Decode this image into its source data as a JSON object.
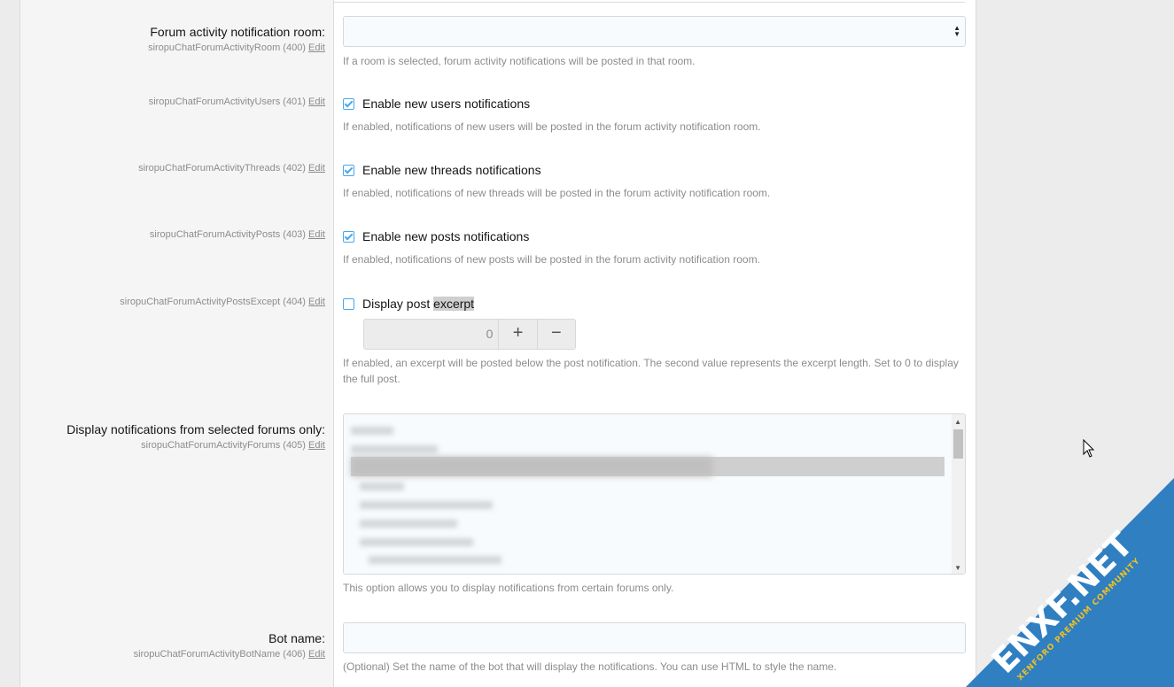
{
  "options": {
    "forum_room": {
      "title": "Forum activity notification room:",
      "id_text": "siropuChatForumActivityRoom (400)",
      "edit": "Edit",
      "selected": "",
      "hint": "If a room is selected, forum activity notifications will be posted in that room."
    },
    "new_users": {
      "id_text": "siropuChatForumActivityUsers (401)",
      "edit": "Edit",
      "label": "Enable new users notifications",
      "checked": true,
      "hint": "If enabled, notifications of new users will be posted in the forum activity notification room."
    },
    "new_threads": {
      "id_text": "siropuChatForumActivityThreads (402)",
      "edit": "Edit",
      "label": "Enable new threads notifications",
      "checked": true,
      "hint": "If enabled, notifications of new threads will be posted in the forum activity notification room."
    },
    "new_posts": {
      "id_text": "siropuChatForumActivityPosts (403)",
      "edit": "Edit",
      "label": "Enable new posts notifications",
      "checked": true,
      "hint": "If enabled, notifications of new posts will be posted in the forum activity notification room."
    },
    "post_excerpt": {
      "id_text": "siropuChatForumActivityPostsExcept (404)",
      "edit": "Edit",
      "label_prefix": "Display post ",
      "label_highlight": "excerpt",
      "checked": false,
      "value": "0",
      "plus": "+",
      "minus": "−",
      "hint": "If enabled, an excerpt will be posted below the post notification. The second value represents the excerpt length. Set to 0 to display the full post."
    },
    "forums": {
      "title": "Display notifications from selected forums only:",
      "id_text": "siropuChatForumActivityForums (405)",
      "edit": "Edit",
      "hint": "This option allows you to display notifications from certain forums only."
    },
    "bot_name": {
      "title": "Bot name:",
      "id_text": "siropuChatForumActivityBotName (406)",
      "edit": "Edit",
      "value": "",
      "hint": "(Optional) Set the name of the bot that will display the notifications. You can use HTML to style the name."
    }
  },
  "watermark": {
    "brand": "ENXF.NET",
    "tagline": "XENFORO PREMIUM COMMUNITY"
  },
  "colors": {
    "accent": "#47a7eb",
    "watermark_blue": "#2f7fc1"
  },
  "icons": {
    "cursor": "mouse-pointer-icon",
    "select": "select-arrows-icon"
  }
}
